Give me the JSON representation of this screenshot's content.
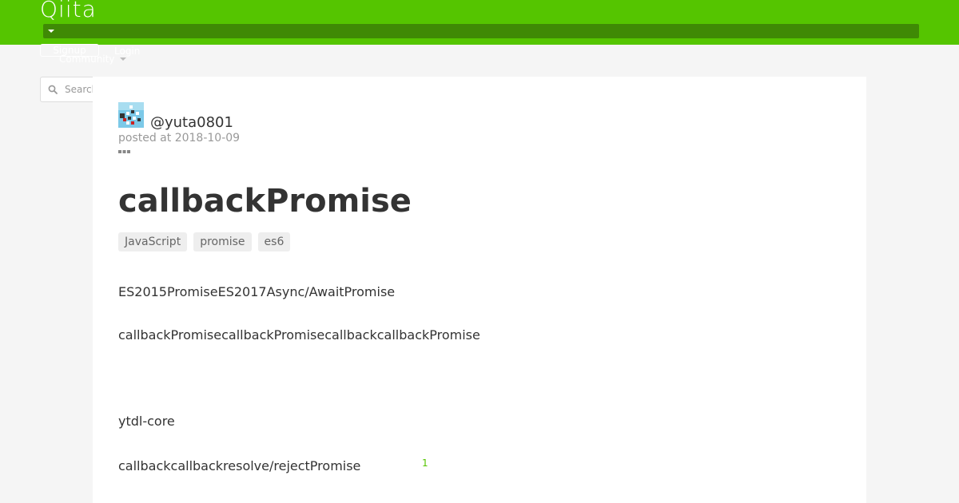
{
  "header": {
    "logo_text": "Qiita",
    "signup_label": "Signup",
    "login_label": "Login",
    "community_label": "Community"
  },
  "search": {
    "placeholder": "Search"
  },
  "article": {
    "author": "@yuta0801",
    "posted": "posted at 2018-10-09",
    "title": "callbackPromise",
    "tags": [
      "JavaScript",
      "promise",
      "es6"
    ],
    "paragraphs": [
      "ES2015PromiseES2017Async/AwaitPromise",
      "callbackPromisecallbackPromisecallbackcallbackPromise",
      "ytdl-core",
      "callbackcallbackresolve/rejectPromise"
    ],
    "footnote_ref": "1"
  },
  "colors": {
    "brand": "#55c500",
    "header_dark": "#3f8a05"
  },
  "icons": {
    "search": "search-icon",
    "more": "more-icon",
    "caret": "chevron-down-icon"
  }
}
